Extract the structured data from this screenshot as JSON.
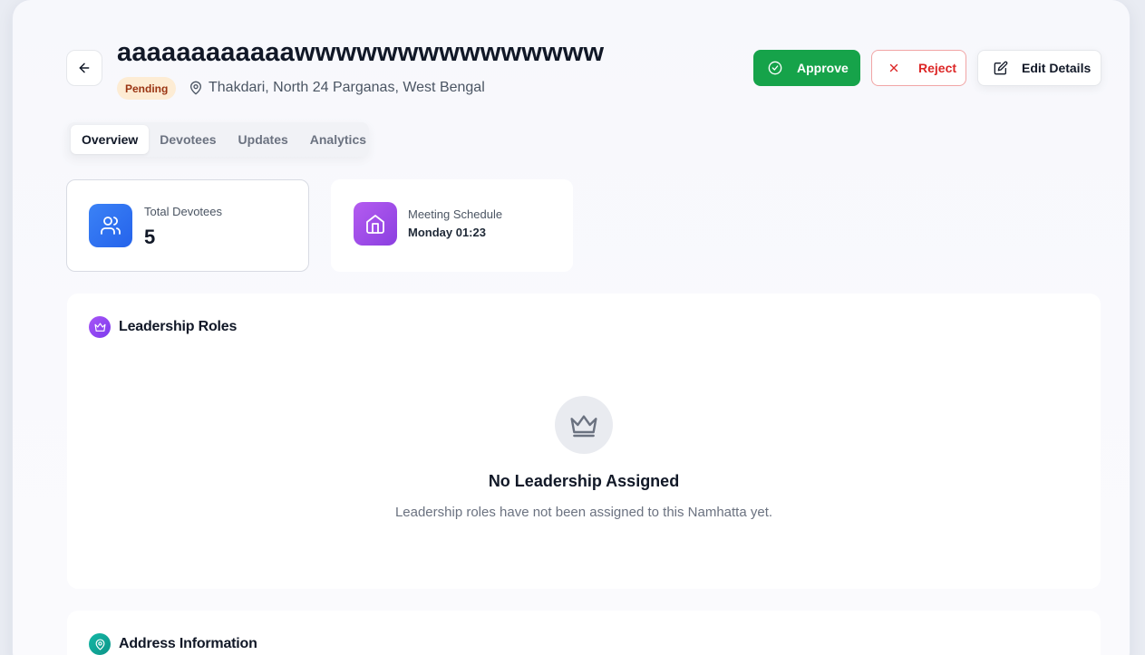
{
  "header": {
    "title": "aaaaaaaaaaaawwwwwwwwwwwwwww",
    "status": "Pending",
    "location": "Thakdari, North 24 Parganas, West Bengal"
  },
  "actions": {
    "approve_label": "Approve",
    "reject_label": "Reject",
    "edit_label": "Edit Details"
  },
  "tabs": [
    {
      "label": "Overview",
      "active": true
    },
    {
      "label": "Devotees",
      "active": false
    },
    {
      "label": "Updates",
      "active": false
    },
    {
      "label": "Analytics",
      "active": false
    }
  ],
  "stats": {
    "devotees": {
      "label": "Total Devotees",
      "value": "5",
      "icon": "users-icon"
    },
    "meeting": {
      "label": "Meeting Schedule",
      "value": "Monday 01:23",
      "icon": "home-icon"
    }
  },
  "leadership": {
    "title": "Leadership Roles",
    "icon": "crown-icon",
    "empty_title": "No Leadership Assigned",
    "empty_desc": "Leadership roles have not been assigned to this Namhatta yet."
  },
  "address": {
    "title": "Address Information",
    "icon": "map-pin-icon"
  },
  "colors": {
    "approve": "#16a34a",
    "reject": "#dc2626",
    "pending_bg": "#fdecd4",
    "pending_text": "#9a3412",
    "blue": "#3b82f6",
    "purple": "#a855f7",
    "teal": "#0d9488"
  }
}
